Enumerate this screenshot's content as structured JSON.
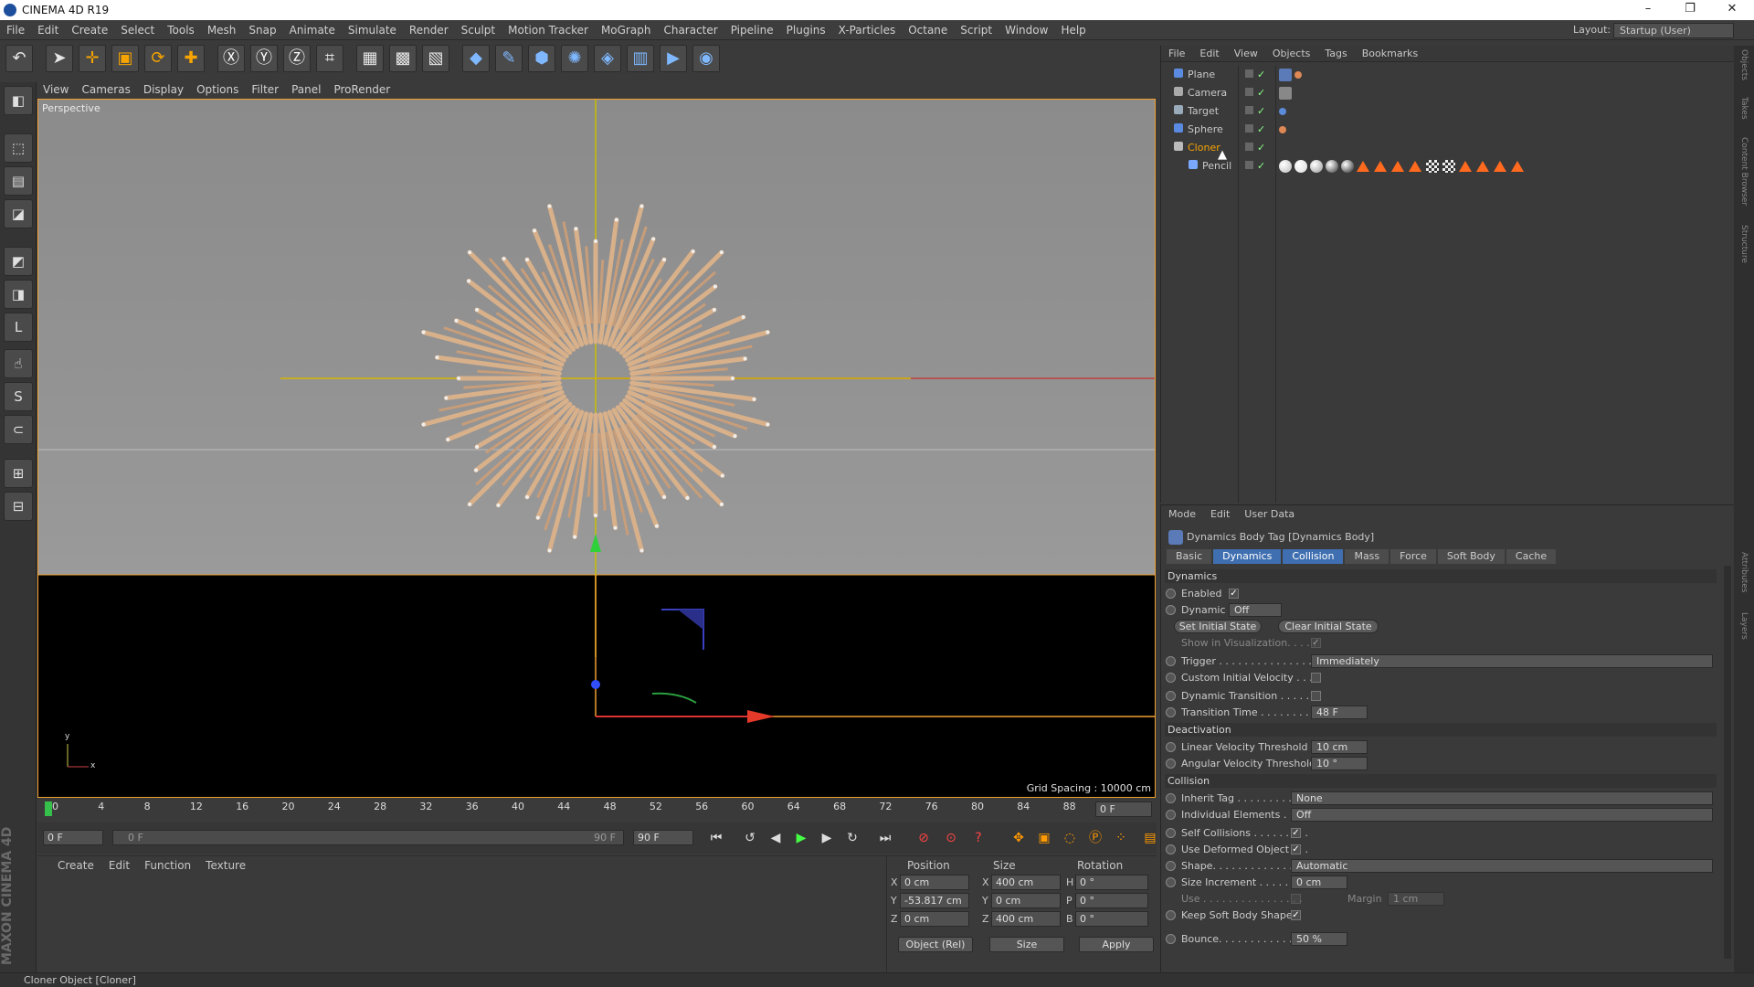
{
  "window": {
    "title": "CINEMA 4D R19",
    "minimize": "–",
    "maximize": "❐",
    "close": "✕"
  },
  "menus": [
    "File",
    "Edit",
    "Create",
    "Select",
    "Tools",
    "Mesh",
    "Snap",
    "Animate",
    "Simulate",
    "Render",
    "Sculpt",
    "Motion Tracker",
    "MoGraph",
    "Character",
    "Pipeline",
    "Plugins",
    "X-Particles",
    "Octane",
    "Script",
    "Window",
    "Help"
  ],
  "layout": {
    "label": "Layout:",
    "value": "Startup (User)"
  },
  "toolbar_icons": [
    "undo-icon",
    "select-icon",
    "move-icon",
    "scale-icon",
    "rotate-icon",
    "add-icon",
    "x-axis-icon",
    "y-axis-icon",
    "z-axis-icon",
    "coordinate-system-icon",
    "render-view-icon",
    "render-picture-viewer-icon",
    "edit-render-settings-icon",
    "cube-icon",
    "pen-icon",
    "subdivision-icon",
    "cloner-icon",
    "deformer-icon",
    "floor-icon",
    "camera-icon",
    "light-icon"
  ],
  "viewport": {
    "menu": [
      "View",
      "Cameras",
      "Display",
      "Options",
      "Filter",
      "Panel",
      "ProRender"
    ],
    "label": "Perspective",
    "grid_spacing": "Grid Spacing : 10000 cm",
    "axis_y": "y",
    "axis_x": "x"
  },
  "timeline": {
    "ticks": [
      "0",
      "4",
      "8",
      "12",
      "16",
      "20",
      "24",
      "28",
      "32",
      "36",
      "40",
      "44",
      "48",
      "52",
      "56",
      "60",
      "64",
      "68",
      "72",
      "76",
      "80",
      "84",
      "88"
    ],
    "current_frame": "0 F",
    "start": "0 F",
    "range_start": "0 F",
    "range_end": "90 F",
    "end": "90 F"
  },
  "material_menu": [
    "Create",
    "Edit",
    "Function",
    "Texture"
  ],
  "coordinates": {
    "headers": [
      "Position",
      "Size",
      "Rotation"
    ],
    "rows": [
      {
        "axis": "X",
        "pos": "0 cm",
        "saxis": "X",
        "size": "400 cm",
        "raxis": "H",
        "rot": "0 °"
      },
      {
        "axis": "Y",
        "pos": "-53.817 cm",
        "saxis": "Y",
        "size": "0 cm",
        "raxis": "P",
        "rot": "0 °"
      },
      {
        "axis": "Z",
        "pos": "0 cm",
        "saxis": "Z",
        "size": "400 cm",
        "raxis": "B",
        "rot": "0 °"
      }
    ],
    "mode": "Object (Rel)",
    "size_mode": "Size",
    "apply": "Apply"
  },
  "object_manager": {
    "menu": [
      "File",
      "Edit",
      "View",
      "Objects",
      "Tags",
      "Bookmarks"
    ],
    "objects": [
      {
        "name": "Plane",
        "indent": 0
      },
      {
        "name": "Camera",
        "indent": 0
      },
      {
        "name": "Target",
        "indent": 0
      },
      {
        "name": "Sphere",
        "indent": 0
      },
      {
        "name": "Cloner",
        "indent": 0
      },
      {
        "name": "Pencil",
        "indent": 1
      }
    ]
  },
  "attributes": {
    "menu": [
      "Mode",
      "Edit",
      "User Data"
    ],
    "title": "Dynamics Body Tag [Dynamics Body]",
    "tabs": [
      "Basic",
      "Dynamics",
      "Collision",
      "Mass",
      "Force",
      "Soft Body",
      "Cache"
    ],
    "sections": {
      "dynamics": "Dynamics",
      "deactivation": "Deactivation",
      "collision": "Collision"
    },
    "enabled": "Enabled",
    "dynamic": "Dynamic",
    "dynamic_value": "Off",
    "set_initial": "Set Initial State",
    "clear_initial": "Clear Initial State",
    "show_vis": "Show in Visualization. . . . .",
    "trigger": "Trigger . . . . . . . . . . . . . . .",
    "trigger_value": "Immediately",
    "custom_vel": "Custom Initial Velocity . . .",
    "dyn_trans": "Dynamic Transition . . . . . . .",
    "trans_time": "Transition Time . . . . . . . . .",
    "trans_time_value": "48 F",
    "lin_vel": "Linear Velocity Threshold",
    "lin_vel_value": "10 cm",
    "ang_vel": "Angular Velocity Threshold",
    "ang_vel_value": "10 °",
    "inherit": "Inherit Tag . . . . . . . . . . . .",
    "inherit_value": "None",
    "indiv": "Individual Elements . . .",
    "indiv_value": "Off",
    "self_coll": "Self Collisions . . . . . . . . .",
    "deformed": "Use Deformed Object . . .",
    "shape": "Shape. . . . . . . . . . . . . . . .",
    "shape_value": "Automatic",
    "size_inc": "Size Increment . . . . . . . . .",
    "size_inc_value": "0 cm",
    "use": "Use . . . . . . . . . . . . . . . .",
    "margin": "Margin",
    "margin_value": "1 cm",
    "keep_soft": "Keep Soft Body Shape",
    "bounce": "Bounce. . . . . . . . . . . . . . .",
    "bounce_value": "50 %"
  },
  "side_tabs": [
    "Objects",
    "Takes",
    "Content Browser",
    "Structure",
    "Attributes",
    "Layers"
  ],
  "status": "Cloner Object [Cloner]",
  "brand": "MAXON CINEMA 4D"
}
